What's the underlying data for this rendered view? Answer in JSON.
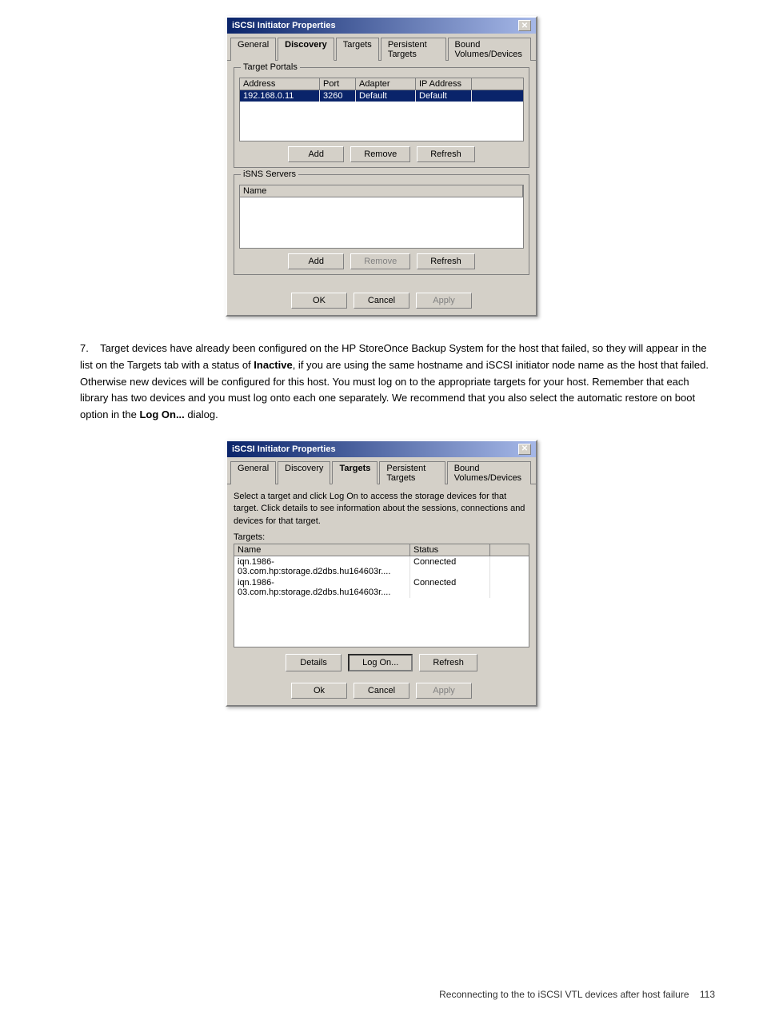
{
  "dialog1": {
    "title": "iSCSI Initiator Properties",
    "tabs": [
      "General",
      "Discovery",
      "Targets",
      "Persistent Targets",
      "Bound Volumes/Devices"
    ],
    "active_tab": "Discovery",
    "target_portals": {
      "label": "Target Portals",
      "columns": [
        "Address",
        "Port",
        "Adapter",
        "IP Address"
      ],
      "rows": [
        {
          "address": "192.168.0.11",
          "port": "3260",
          "adapter": "Default",
          "ip": "Default",
          "selected": true
        }
      ]
    },
    "isns_servers": {
      "label": "iSNS Servers",
      "columns": [
        "Name"
      ],
      "rows": []
    },
    "buttons_portals": {
      "add": "Add",
      "remove": "Remove",
      "refresh": "Refresh"
    },
    "buttons_isns": {
      "add": "Add",
      "remove": "Remove",
      "refresh": "Refresh"
    },
    "footer": {
      "ok": "OK",
      "cancel": "Cancel",
      "apply": "Apply"
    }
  },
  "step": {
    "number": "7.",
    "text_parts": [
      "Target devices have already been configured on the HP StoreOnce Backup System for the host that failed, so they will appear in the list on the Targets tab with a status of ",
      "Inactive",
      ", if you are using the same hostname and iSCSI initiator node name as the host that failed. Otherwise new devices will be configured for this host. You must log on to the appropriate targets for your host. Remember that each library has two devices and you must log onto each one separately. We recommend that you also select the automatic restore on boot option in the ",
      "Log On...",
      " dialog."
    ]
  },
  "dialog2": {
    "title": "iSCSI Initiator Properties",
    "tabs": [
      "General",
      "Discovery",
      "Targets",
      "Persistent Targets",
      "Bound Volumes/Devices"
    ],
    "active_tab": "Targets",
    "info_text": "Select a target and click Log On to access the storage devices for that target. Click details to see information about the sessions, connections and devices for that target.",
    "targets_label": "Targets:",
    "columns": [
      "Name",
      "Status"
    ],
    "rows": [
      {
        "name": "iqn.1986-03.com.hp:storage.d2dbs.hu164603r....",
        "status": "Connected"
      },
      {
        "name": "iqn.1986-03.com.hp:storage.d2dbs.hu164603r....",
        "status": "Connected"
      }
    ],
    "buttons": {
      "details": "Details",
      "logon": "Log On...",
      "refresh": "Refresh"
    },
    "footer": {
      "ok": "Ok",
      "cancel": "Cancel",
      "apply": "Apply"
    }
  },
  "footer": {
    "text": "Reconnecting to the to iSCSI VTL devices after host failure",
    "page": "113"
  }
}
